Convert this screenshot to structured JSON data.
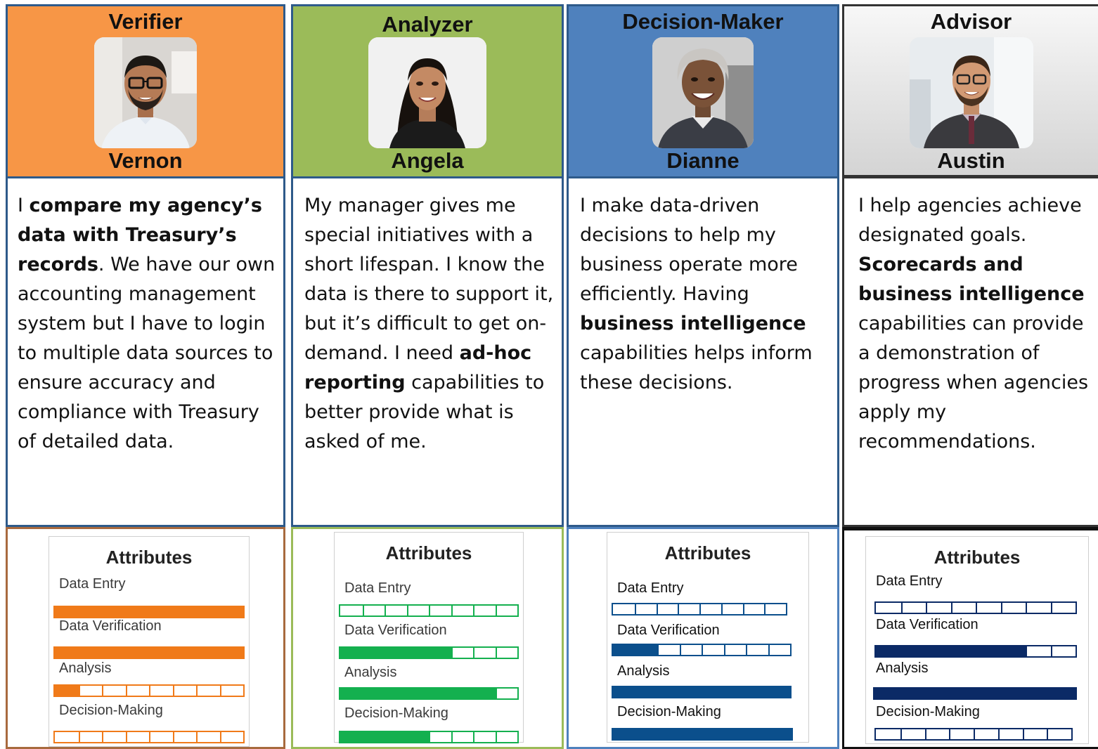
{
  "colors": {
    "verifier": "#f79646",
    "analyzer": "#9bbb59",
    "decision_maker": "#4f81bd",
    "advisor": "#e4e4e4",
    "bar_orange": "#f07a19",
    "bar_green": "#14b04f",
    "bar_blue": "#0b4f8c",
    "bar_navy": "#0b2a66"
  },
  "personas": [
    {
      "role": "Verifier",
      "name": "Vernon",
      "photo_icon": "vernon-portrait-photo",
      "description": [
        {
          "t": "I ",
          "b": false
        },
        {
          "t": "compare my agency’s data with Treasury’s records",
          "b": true
        },
        {
          "t": ". We have our own accounting management system but I have to login to multiple data sources to ensure accuracy and compliance with Treasury of detailed data.",
          "b": false
        }
      ],
      "attributes_title": "Attributes",
      "attributes": [
        {
          "label": "Data Entry",
          "level": 1.0
        },
        {
          "label": "Data Verification",
          "level": 1.0
        },
        {
          "label": "Analysis",
          "level": 0.125
        },
        {
          "label": "Decision-Making",
          "level": 0.0
        }
      ]
    },
    {
      "role": "Analyzer",
      "name": "Angela",
      "photo_icon": "angela-portrait-photo",
      "description": [
        {
          "t": "My manager gives me special initiatives with a short lifespan. I know the data is there to support it, but it’s difficult to get on-demand. I need ",
          "b": false
        },
        {
          "t": "ad-hoc reporting",
          "b": true
        },
        {
          "t": " capabilities to better provide what is asked of me.",
          "b": false
        }
      ],
      "attributes_title": "Attributes",
      "attributes": [
        {
          "label": "Data Entry",
          "level": 0.0
        },
        {
          "label": "Data Verification",
          "level": 0.625
        },
        {
          "label": "Analysis",
          "level": 0.875
        },
        {
          "label": "Decision-Making",
          "level": 0.5
        }
      ]
    },
    {
      "role": "Decision-Maker",
      "name": "Dianne",
      "photo_icon": "dianne-portrait-photo",
      "description": [
        {
          "t": "I make data-driven decisions to help my business operate more efficiently. Having ",
          "b": false
        },
        {
          "t": "business intelligence",
          "b": true
        },
        {
          "t": " capabilities helps inform these decisions.",
          "b": false
        }
      ],
      "attributes_title": "Attributes",
      "attributes": [
        {
          "label": "Data Entry",
          "level": 0.0
        },
        {
          "label": "Data Verification",
          "level": 0.25
        },
        {
          "label": "Analysis",
          "level": 1.0
        },
        {
          "label": "Decision-Making",
          "level": 1.0
        }
      ]
    },
    {
      "role": "Advisor",
      "name": "Austin",
      "photo_icon": "austin-portrait-photo",
      "description": [
        {
          "t": "I help agencies achieve designated goals. ",
          "b": false
        },
        {
          "t": "Scorecards and business intelligence",
          "b": true
        },
        {
          "t": " capabilities can provide a demonstration of progress when agencies apply my recommendations.",
          "b": false
        }
      ],
      "attributes_title": "Attributes",
      "attributes": [
        {
          "label": "Data Entry",
          "level": 0.0
        },
        {
          "label": "Data Verification",
          "level": 0.75
        },
        {
          "label": "Analysis",
          "level": 1.0
        },
        {
          "label": "Decision-Making",
          "level": 0.0
        }
      ]
    }
  ]
}
